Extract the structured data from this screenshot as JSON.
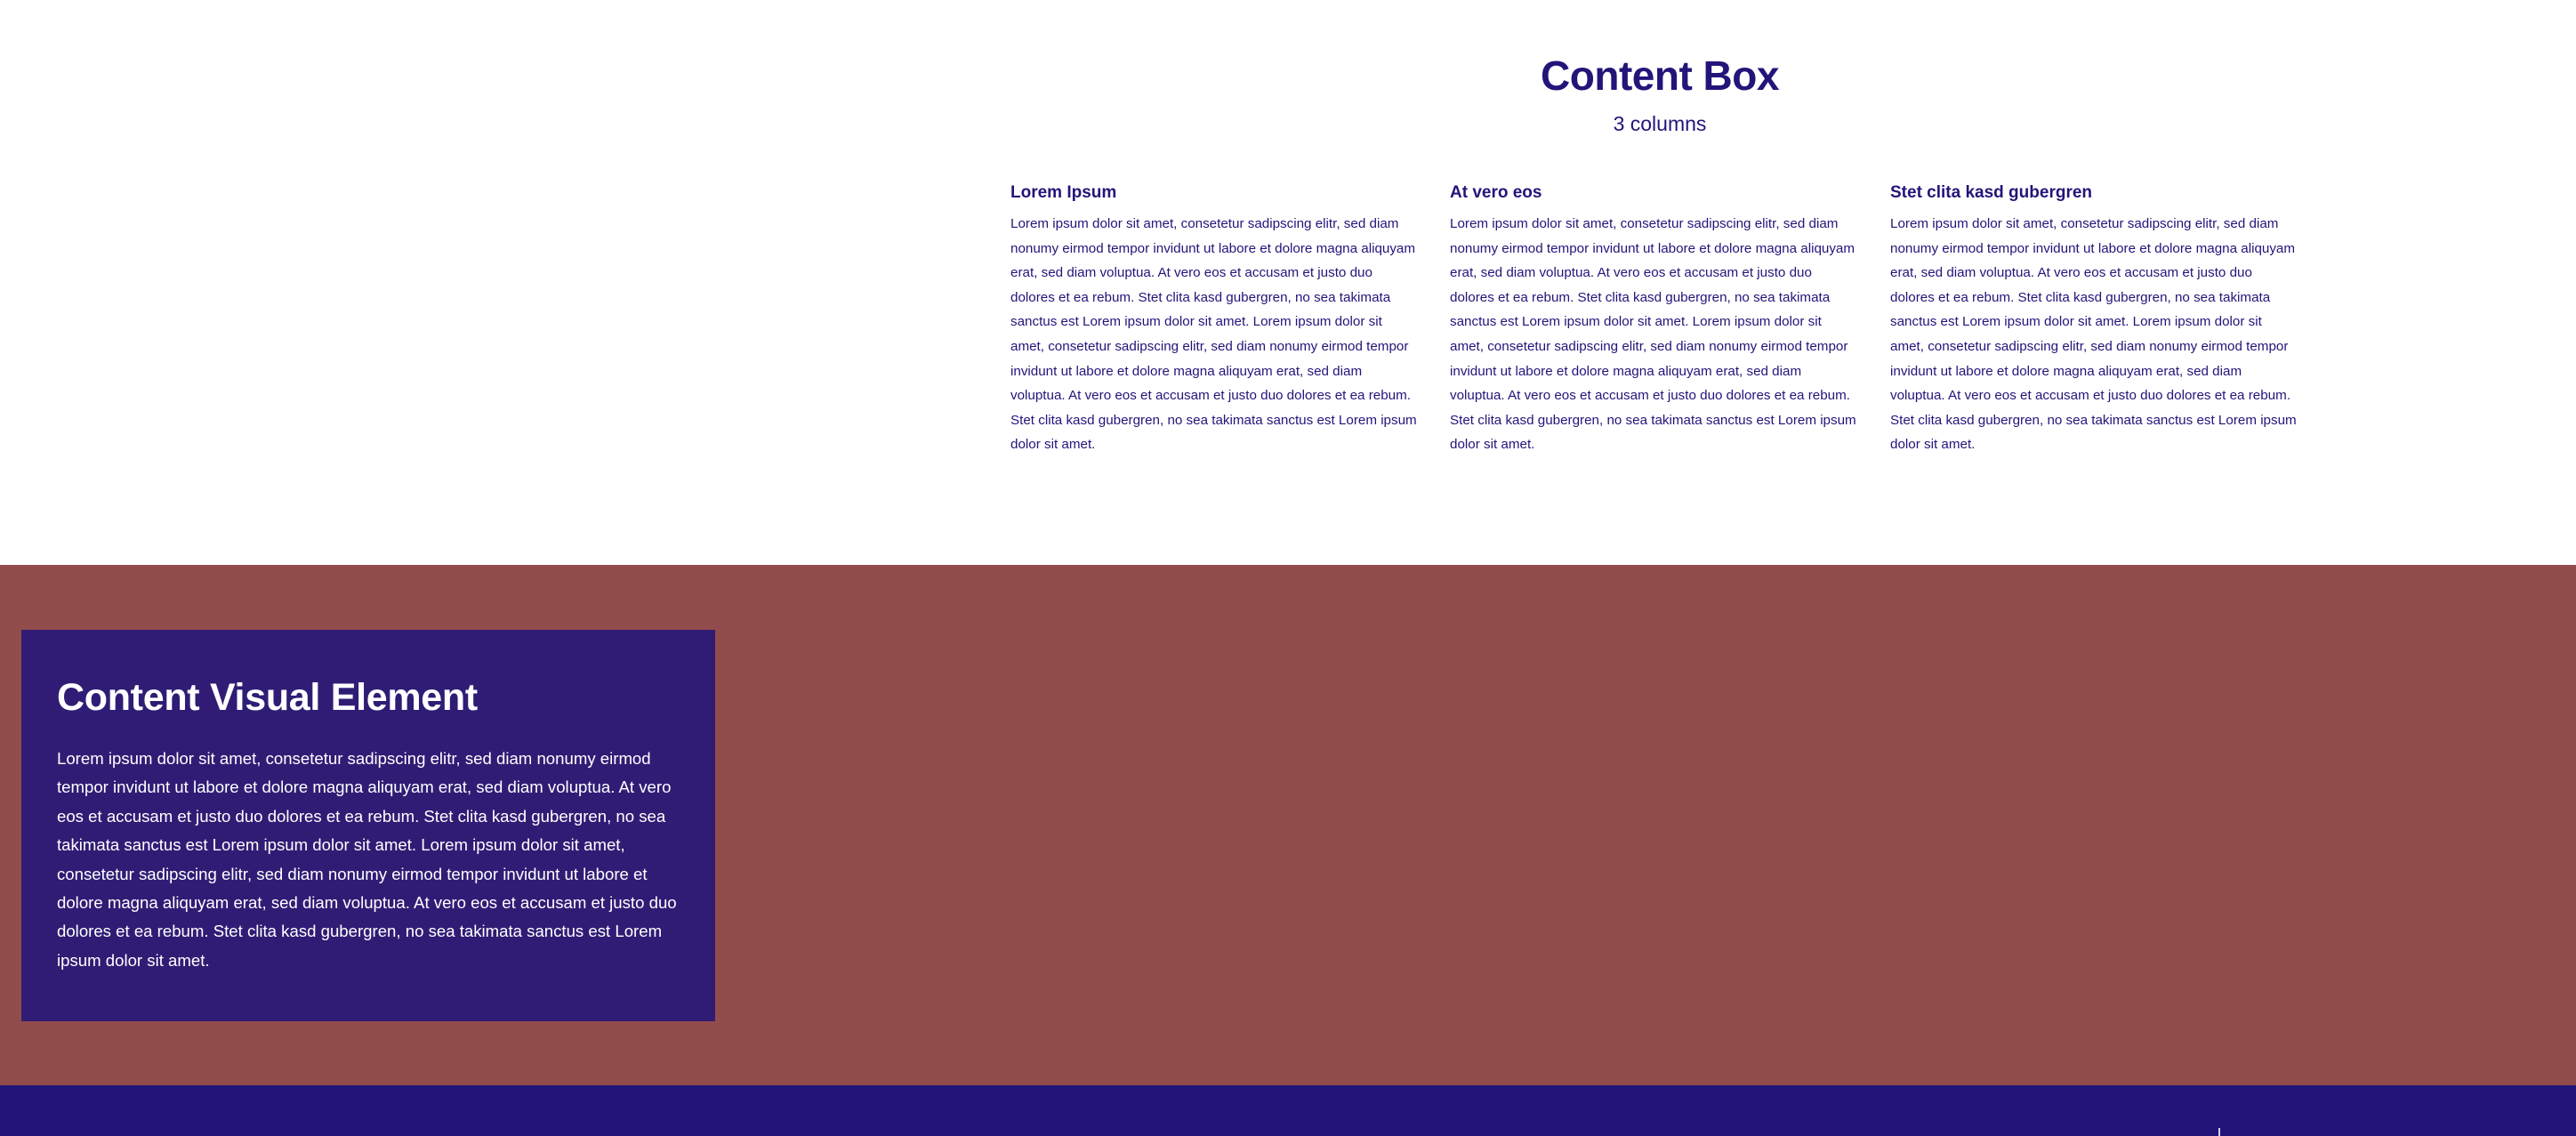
{
  "content_box": {
    "title": "Content Box",
    "subtitle": "3 columns",
    "columns": [
      {
        "heading": "Lorem Ipsum",
        "text": "Lorem ipsum dolor sit amet, consetetur sadipscing elitr, sed diam nonumy eirmod tempor invidunt ut labore et dolore magna aliquyam erat, sed diam voluptua. At vero eos et accusam et justo duo dolores et ea rebum. Stet clita kasd gubergren, no sea takimata sanctus est Lorem ipsum dolor sit amet. Lorem ipsum dolor sit amet, consetetur sadipscing elitr, sed diam nonumy eirmod tempor invidunt ut labore et dolore magna aliquyam erat, sed diam voluptua. At vero eos et accusam et justo duo dolores et ea rebum. Stet clita kasd gubergren, no sea takimata sanctus est Lorem ipsum dolor sit amet."
      },
      {
        "heading": "At vero eos",
        "text": "Lorem ipsum dolor sit amet, consetetur sadipscing elitr, sed diam nonumy eirmod tempor invidunt ut labore et dolore magna aliquyam erat, sed diam voluptua. At vero eos et accusam et justo duo dolores et ea rebum. Stet clita kasd gubergren, no sea takimata sanctus est Lorem ipsum dolor sit amet. Lorem ipsum dolor sit amet, consetetur sadipscing elitr, sed diam nonumy eirmod tempor invidunt ut labore et dolore magna aliquyam erat, sed diam voluptua. At vero eos et accusam et justo duo dolores et ea rebum. Stet clita kasd gubergren, no sea takimata sanctus est Lorem ipsum dolor sit amet."
      },
      {
        "heading": "Stet clita kasd gubergren",
        "text": "Lorem ipsum dolor sit amet, consetetur sadipscing elitr, sed diam nonumy eirmod tempor invidunt ut labore et dolore magna aliquyam erat, sed diam voluptua. At vero eos et accusam et justo duo dolores et ea rebum. Stet clita kasd gubergren, no sea takimata sanctus est Lorem ipsum dolor sit amet. Lorem ipsum dolor sit amet, consetetur sadipscing elitr, sed diam nonumy eirmod tempor invidunt ut labore et dolore magna aliquyam erat, sed diam voluptua. At vero eos et accusam et justo duo dolores et ea rebum. Stet clita kasd gubergren, no sea takimata sanctus est Lorem ipsum dolor sit amet."
      }
    ]
  },
  "visual_element": {
    "title": "Content Visual Element",
    "text": "Lorem ipsum dolor sit amet, consetetur sadipscing elitr, sed diam nonumy eirmod tempor invidunt ut labore et dolore magna aliquyam erat, sed diam voluptua. At vero eos et accusam et justo duo dolores et ea rebum. Stet clita kasd gubergren, no sea takimata sanctus est Lorem ipsum dolor sit amet. Lorem ipsum dolor sit amet, consetetur sadipscing elitr, sed diam nonumy eirmod tempor invidunt ut labore et dolore magna aliquyam erat, sed diam voluptua. At vero eos et accusam et justo duo dolores et ea rebum. Stet clita kasd gubergren, no sea takimata sanctus est Lorem ipsum dolor sit amet."
  },
  "colors": {
    "primary": "#22157a",
    "visual_background": "#924c4c",
    "card_background": "#311c75",
    "page_background": "#ffffff"
  }
}
